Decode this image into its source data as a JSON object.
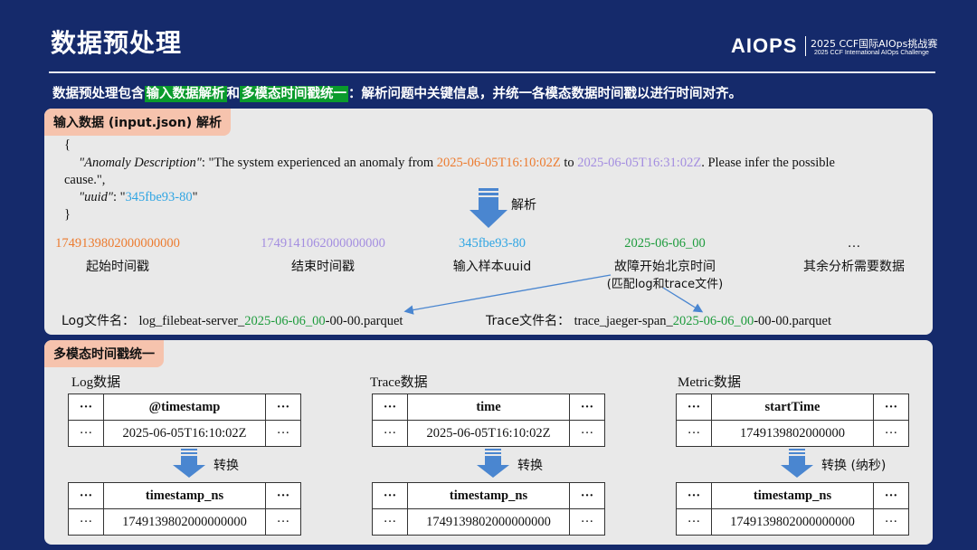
{
  "slide": {
    "title": "数据预处理",
    "logo": {
      "mark": "AIOPS",
      "cn": "2025 CCF国际AIOps挑战赛",
      "en": "2025 CCF International AIOps Challenge"
    },
    "intro": {
      "prefix": "数据预处理包含",
      "hl1": "输入数据解析",
      "mid": "和",
      "hl2": "多模态时间戳统一",
      "suffix": "：解析问题中关键信息，并统一各模态数据时间戳以进行时间对齐。"
    }
  },
  "input_section": {
    "tag": "输入数据 (input.json) 解析",
    "json": {
      "open": "{",
      "key1": "\"Anomaly Description\"",
      "colon1": ": ",
      "text1": "\"The system experienced an anomaly from ",
      "start_time": "2025-06-05T16:10:02Z",
      "to": " to ",
      "end_time": "2025-06-05T16:31:02Z",
      "text2": ". Please infer the possible",
      "text3": "cause.\",",
      "key2": "\"uuid\"",
      "colon2": ": \"",
      "uuid": "345fbe93-80",
      "quote": "\"",
      "close": "}"
    },
    "arrow_label": "解析",
    "fields": [
      {
        "value": "1749139802000000000",
        "label": "起始时间戳"
      },
      {
        "value": "1749141062000000000",
        "label": "结束时间戳"
      },
      {
        "value": "345fbe93-80",
        "label": "输入样本uuid"
      },
      {
        "value": "2025-06-06_00",
        "label": "故障开始北京时间",
        "sublabel": "(匹配log和trace文件)"
      },
      {
        "value": "…",
        "label": "其余分析需要数据"
      }
    ],
    "log_file": {
      "label": "Log文件名：",
      "prefix": "log_filebeat-server_",
      "date": "2025-06-06_00",
      "suffix": "-00-00.parquet"
    },
    "trace_file": {
      "label": "Trace文件名：",
      "prefix": "trace_jaeger-span_",
      "date": "2025-06-06_00",
      "suffix": "-00-00.parquet"
    }
  },
  "timestamp_section": {
    "tag": "多模态时间戳统一",
    "groups": [
      {
        "title": "Log数据",
        "before": {
          "dots": "···",
          "header": "@timestamp",
          "value": "2025-06-05T16:10:02Z"
        },
        "convert_label": "转换",
        "after": {
          "dots": "···",
          "header": "timestamp_ns",
          "value": "1749139802000000000"
        }
      },
      {
        "title": "Trace数据",
        "before": {
          "dots": "···",
          "header": "time",
          "value": "2025-06-05T16:10:02Z"
        },
        "convert_label": "转换",
        "after": {
          "dots": "···",
          "header": "timestamp_ns",
          "value": "1749139802000000000"
        }
      },
      {
        "title": "Metric数据",
        "before": {
          "dots": "···",
          "header": "startTime",
          "value": "1749139802000000"
        },
        "convert_label": "转换 (纳秒)",
        "after": {
          "dots": "···",
          "header": "timestamp_ns",
          "value": "1749139802000000000"
        }
      }
    ]
  },
  "colors": {
    "background": "#152a6b",
    "panel": "#e9e9e9",
    "tag": "#f6c3ad",
    "highlight": "#0a9b2c",
    "start_time": "#ec7b2f",
    "end_time": "#a48ee0",
    "uuid": "#2fa5e3",
    "date": "#1d9b3c",
    "arrow": "#4a86d0"
  },
  "icons": {
    "parse_arrow": "down-arrow-icon",
    "convert_arrow": "down-arrow-icon",
    "link_arrow": "pointer-arrow-icon"
  }
}
